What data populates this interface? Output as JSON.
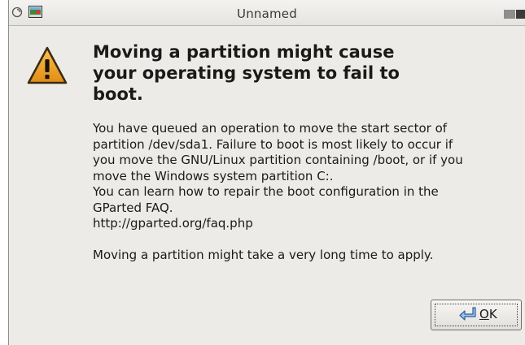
{
  "window": {
    "title": "Unnamed"
  },
  "dialog": {
    "icon": "warning-icon",
    "primary_lines": [
      "Moving a partition might cause",
      "your operating system to fail to",
      "boot."
    ],
    "secondary_lines": [
      "You have queued an operation to move the start sector of",
      "partition /dev/sda1.  Failure to boot is most likely to occur if",
      "you move the GNU/Linux partition containing /boot, or if you",
      "move the Windows system partition C:.",
      "You can learn how to repair the boot configuration in the",
      "GParted FAQ.",
      "http://gparted.org/faq.php",
      "",
      "Moving a partition might take a very long time to apply."
    ]
  },
  "buttons": {
    "ok_mnemonic": "O",
    "ok_rest": "K",
    "ok_icon": "ok-arrow-icon"
  },
  "colors": {
    "window_bg": "#edebe7",
    "warning_fill": "#f0a42a",
    "warning_stroke": "#3b2a12"
  }
}
